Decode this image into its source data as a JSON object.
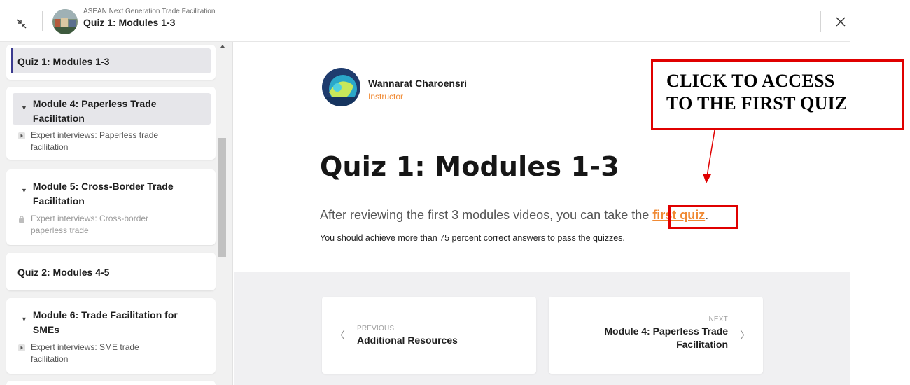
{
  "header": {
    "course_subtitle": "ASEAN Next Generation Trade Facilitation",
    "course_title": "Quiz 1: Modules 1-3"
  },
  "sidebar": {
    "items": [
      {
        "label": "Quiz 1: Modules 1-3",
        "active": true
      },
      {
        "label_line1": "Module 4: Paperless Trade",
        "label_line2": "Facilitation",
        "sub_line1": "Expert interviews: Paperless trade",
        "sub_line2": "facilitation",
        "sub_icon": "play-icon"
      },
      {
        "label_line1": "Module 5: Cross-Border Trade",
        "label_line2": "Facilitation",
        "sub_line1": "Expert interviews: Cross-border",
        "sub_line2": "paperless trade",
        "sub_icon": "lock-icon"
      },
      {
        "label": "Quiz 2: Modules 4-5"
      },
      {
        "label_line1": "Module 6: Trade Facilitation for",
        "label_line2": "SMEs",
        "sub_line1": "Expert interviews: SME trade",
        "sub_line2": "facilitation",
        "sub_icon": "play-icon"
      }
    ]
  },
  "main": {
    "instructor_name": "Wannarat Charoensri",
    "instructor_role": "Instructor",
    "title": "Quiz 1: Modules 1-3",
    "intro_text": "After reviewing the first 3 modules videos, you can take the ",
    "intro_link": "first quiz",
    "intro_end": ".",
    "note": "You should achieve more than 75 percent correct answers to pass the quizzes."
  },
  "nav": {
    "prev_small": "PREVIOUS",
    "prev_label": "Additional Resources",
    "next_small": "NEXT",
    "next_line1": "Module 4: Paperless Trade",
    "next_line2": "Facilitation"
  },
  "annotation": {
    "line1": "CLICK TO ACCESS",
    "line2": "TO THE FIRST QUIZ",
    "color": "#e00000"
  },
  "colors": {
    "accent": "#f08a34",
    "active_bar": "#3b3b8f"
  }
}
